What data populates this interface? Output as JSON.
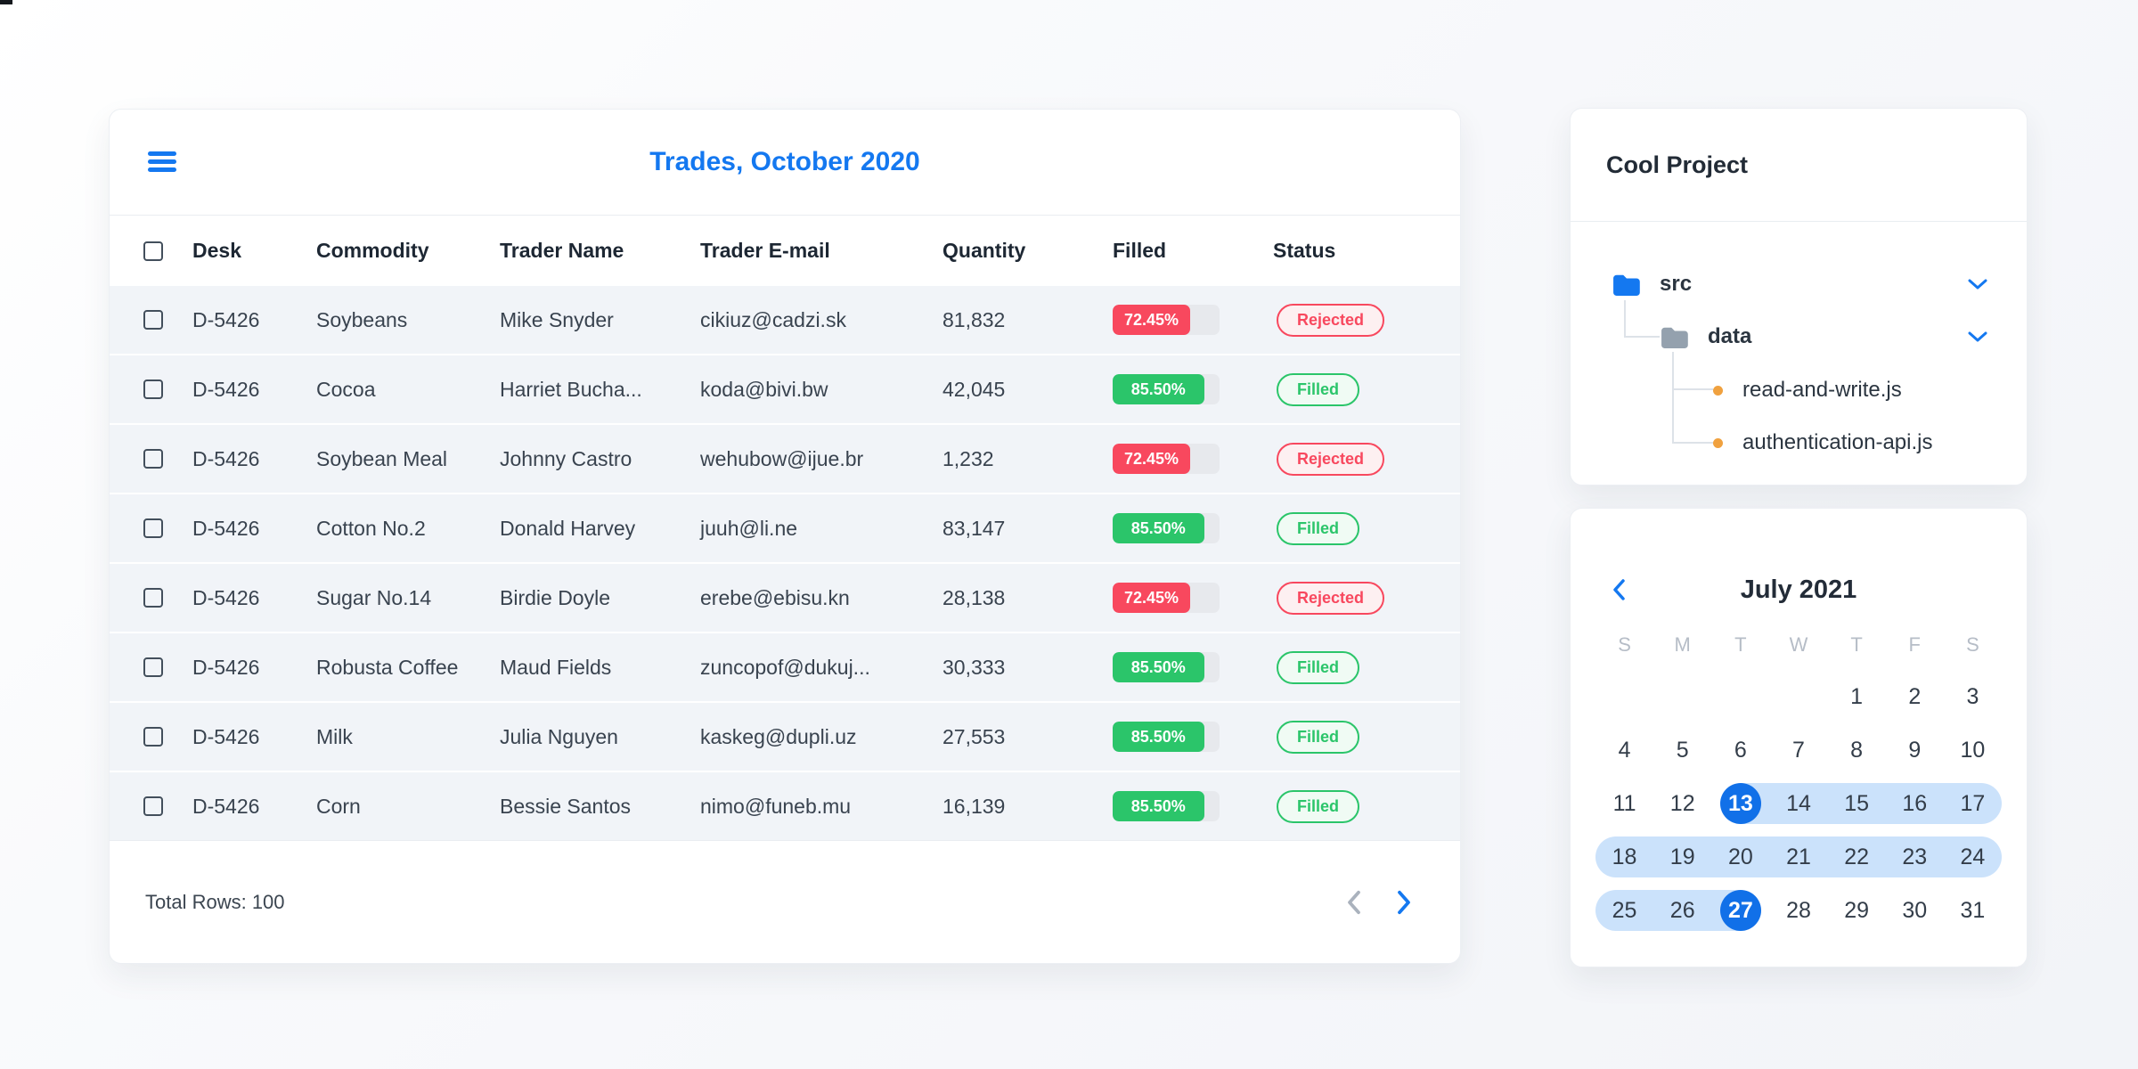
{
  "colors": {
    "accent": "#1478f0",
    "red": "#f8485e",
    "green": "#2bc56a",
    "range_band": "#cbe2fb",
    "selected_day": "#1170e8",
    "file_dot_orange": "#f0a13f",
    "folder_gray": "#94a1ae",
    "folder_blue": "#1478f0"
  },
  "trades": {
    "title": "Trades, October 2020",
    "columns": [
      "Desk",
      "Commodity",
      "Trader Name",
      "Trader E-mail",
      "Quantity",
      "Filled",
      "Status"
    ],
    "rows": [
      {
        "desk": "D-5426",
        "commodity": "Soybeans",
        "trader": "Mike Snyder",
        "email": "cikiuz@cadzi.sk",
        "quantity": "81,832",
        "filled_label": "72.45%",
        "filled_value": 72.45,
        "status": "Rejected"
      },
      {
        "desk": "D-5426",
        "commodity": "Cocoa",
        "trader": "Harriet Bucha...",
        "email": "koda@bivi.bw",
        "quantity": "42,045",
        "filled_label": "85.50%",
        "filled_value": 85.5,
        "status": "Filled"
      },
      {
        "desk": "D-5426",
        "commodity": "Soybean Meal",
        "trader": "Johnny Castro",
        "email": "wehubow@ijue.br",
        "quantity": "1,232",
        "filled_label": "72.45%",
        "filled_value": 72.45,
        "status": "Rejected"
      },
      {
        "desk": "D-5426",
        "commodity": "Cotton No.2",
        "trader": "Donald Harvey",
        "email": "juuh@li.ne",
        "quantity": "83,147",
        "filled_label": "85.50%",
        "filled_value": 85.5,
        "status": "Filled"
      },
      {
        "desk": "D-5426",
        "commodity": "Sugar No.14",
        "trader": "Birdie Doyle",
        "email": "erebe@ebisu.kn",
        "quantity": "28,138",
        "filled_label": "72.45%",
        "filled_value": 72.45,
        "status": "Rejected"
      },
      {
        "desk": "D-5426",
        "commodity": "Robusta Coffee",
        "trader": "Maud Fields",
        "email": "zuncopof@dukuj...",
        "quantity": "30,333",
        "filled_label": "85.50%",
        "filled_value": 85.5,
        "status": "Filled"
      },
      {
        "desk": "D-5426",
        "commodity": "Milk",
        "trader": "Julia Nguyen",
        "email": "kaskeg@dupli.uz",
        "quantity": "27,553",
        "filled_label": "85.50%",
        "filled_value": 85.5,
        "status": "Filled"
      },
      {
        "desk": "D-5426",
        "commodity": "Corn",
        "trader": "Bessie Santos",
        "email": "nimo@funeb.mu",
        "quantity": "16,139",
        "filled_label": "85.50%",
        "filled_value": 85.5,
        "status": "Filled"
      }
    ],
    "footer": {
      "total": "Total Rows: 100"
    }
  },
  "project": {
    "title": "Cool Project",
    "folders": [
      {
        "name": "src"
      },
      {
        "name": "data"
      }
    ],
    "files": [
      {
        "name": "read-and-write.js"
      },
      {
        "name": "authentication-api.js"
      }
    ]
  },
  "calendar": {
    "title": "July 2021",
    "weekdays": [
      "S",
      "M",
      "T",
      "W",
      "T",
      "F",
      "S"
    ],
    "weeks": [
      [
        null,
        null,
        null,
        null,
        1,
        2,
        3
      ],
      [
        4,
        5,
        6,
        7,
        8,
        9,
        10
      ],
      [
        11,
        12,
        13,
        14,
        15,
        16,
        17
      ],
      [
        18,
        19,
        20,
        21,
        22,
        23,
        24
      ],
      [
        25,
        26,
        27,
        28,
        29,
        30,
        31
      ]
    ],
    "range": {
      "start": 13,
      "end": 27
    },
    "selected_days": [
      13,
      27
    ]
  }
}
